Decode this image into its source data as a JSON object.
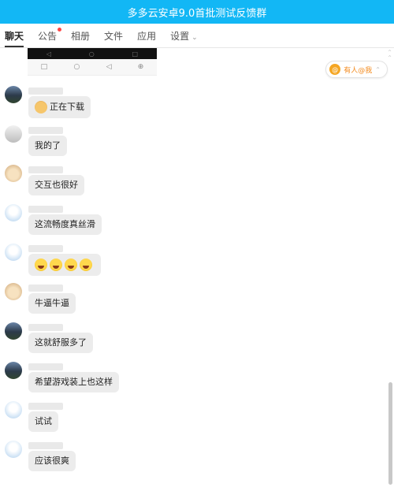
{
  "window": {
    "title": "多多云安卓9.0首批测试反馈群"
  },
  "tabs": [
    {
      "label": "聊天"
    },
    {
      "label": "公告"
    },
    {
      "label": "相册"
    },
    {
      "label": "文件"
    },
    {
      "label": "应用"
    },
    {
      "label": "设置"
    }
  ],
  "mention_bar": {
    "label": "有人@我"
  },
  "messages": [
    {
      "text": "正在下载"
    },
    {
      "text": "我的了"
    },
    {
      "text": "交互也很好"
    },
    {
      "text": "这流畅度真丝滑"
    },
    {
      "text": ""
    },
    {
      "text": "牛逼牛逼"
    },
    {
      "text": "这就舒服多了"
    },
    {
      "text": "希望游戏装上也这样"
    },
    {
      "text": "试试"
    },
    {
      "text": "应该很爽"
    }
  ],
  "icons": {
    "android_nav": [
      "back-triangle-icon",
      "home-circle-icon",
      "recents-square-icon",
      "zoom-icon"
    ],
    "emojis": [
      "dog-emoji-icon",
      "laugh-tears-emoji-icon"
    ]
  },
  "colors": {
    "titlebar": "#12b7f5",
    "bubble": "#ececec",
    "mention_text": "#f38a1d"
  }
}
